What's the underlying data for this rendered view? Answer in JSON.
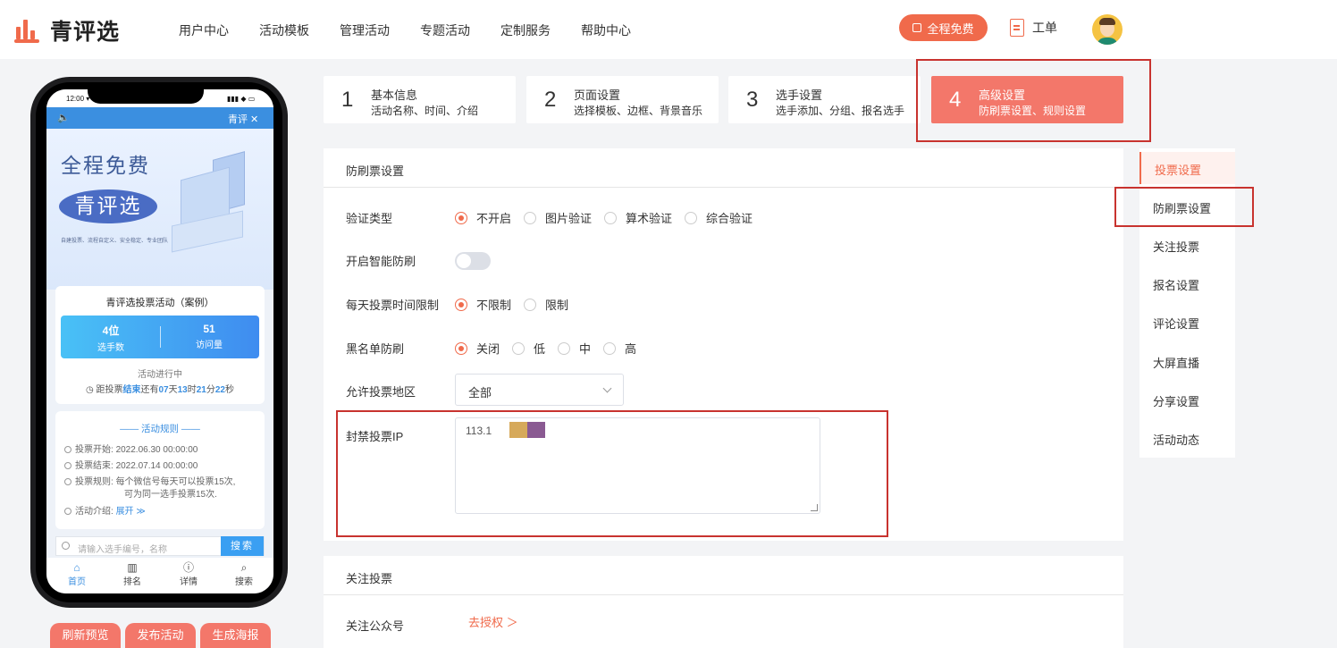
{
  "brand": {
    "name": "青评选",
    "accent": "#f06a4b",
    "step_active": "#f3776a"
  },
  "nav": {
    "items": [
      "用户中心",
      "活动模板",
      "管理活动",
      "专题活动",
      "定制服务",
      "帮助中心"
    ],
    "free_button": "全程免费",
    "ticket": "工单"
  },
  "phone": {
    "status_time": "12:00 ▾",
    "status_icons": "▮▮▮ ◆ ▭",
    "header_icon": "🔈",
    "header_close": "青评 ✕",
    "banner_title": "全程免费",
    "banner_brand": "青评选",
    "banner_small": "自建投票、流程自定义、安全稳定、专业团队",
    "activity_title": "青评选投票活动（案例）",
    "stats": [
      {
        "num": "4位",
        "label": "选手数"
      },
      {
        "num": "51",
        "label": "访问量"
      }
    ],
    "status": "活动进行中",
    "countdown": {
      "prefix": "距投票",
      "end": "结束",
      "mid": "还有",
      "d": "07",
      "du": "天",
      "h": "13",
      "hu": "时",
      "m": "21",
      "mu": "分",
      "s": "22",
      "su": "秒"
    },
    "rules_title": "—— 活动规则 ——",
    "rules": [
      {
        "label": "投票开始:",
        "value": "2022.06.30 00:00:00"
      },
      {
        "label": "投票结束:",
        "value": "2022.07.14 00:00:00"
      },
      {
        "label": "投票规则:",
        "value": "每个微信号每天可以投票15次,",
        "value2": "可为同一选手投票15次."
      },
      {
        "label": "活动介绍:",
        "value": "展开 ≫"
      }
    ],
    "search_placeholder": "请输入选手编号，名称",
    "search_button": "搜索",
    "tabs": [
      {
        "icon": "⌂",
        "label": "首页"
      },
      {
        "icon": "▥",
        "label": "排名"
      },
      {
        "icon": "ⓘ",
        "label": "详情"
      },
      {
        "icon": "⌕",
        "label": "搜索"
      }
    ]
  },
  "bottom_buttons": [
    "刷新预览",
    "发布活动",
    "生成海报"
  ],
  "steps": [
    {
      "num": "1",
      "title": "基本信息",
      "sub": "活动名称、时间、介绍"
    },
    {
      "num": "2",
      "title": "页面设置",
      "sub": "选择模板、边框、背景音乐"
    },
    {
      "num": "3",
      "title": "选手设置",
      "sub": "选手添加、分组、报名选手"
    },
    {
      "num": "4",
      "title": "高级设置",
      "sub": "防刷票设置、规则设置"
    }
  ],
  "anti": {
    "section_title": "防刷票设置",
    "verify_label": "验证类型",
    "verify_options": [
      "不开启",
      "图片验证",
      "算术验证",
      "综合验证"
    ],
    "smart_label": "开启智能防刷",
    "time_label": "每天投票时间限制",
    "time_options": [
      "不限制",
      "限制"
    ],
    "blacklist_label": "黑名单防刷",
    "blacklist_options": [
      "关闭",
      "低",
      "中",
      "高"
    ],
    "region_label": "允许投票地区",
    "region_value": "全部",
    "ip_label": "封禁投票IP",
    "ip_value": "113.1"
  },
  "follow": {
    "section_title": "关注投票",
    "account_label": "关注公众号",
    "auth_link": "去授权 ＞"
  },
  "sidebar": {
    "items": [
      "投票设置",
      "防刷票设置",
      "关注投票",
      "报名设置",
      "评论设置",
      "大屏直播",
      "分享设置",
      "活动动态"
    ]
  }
}
